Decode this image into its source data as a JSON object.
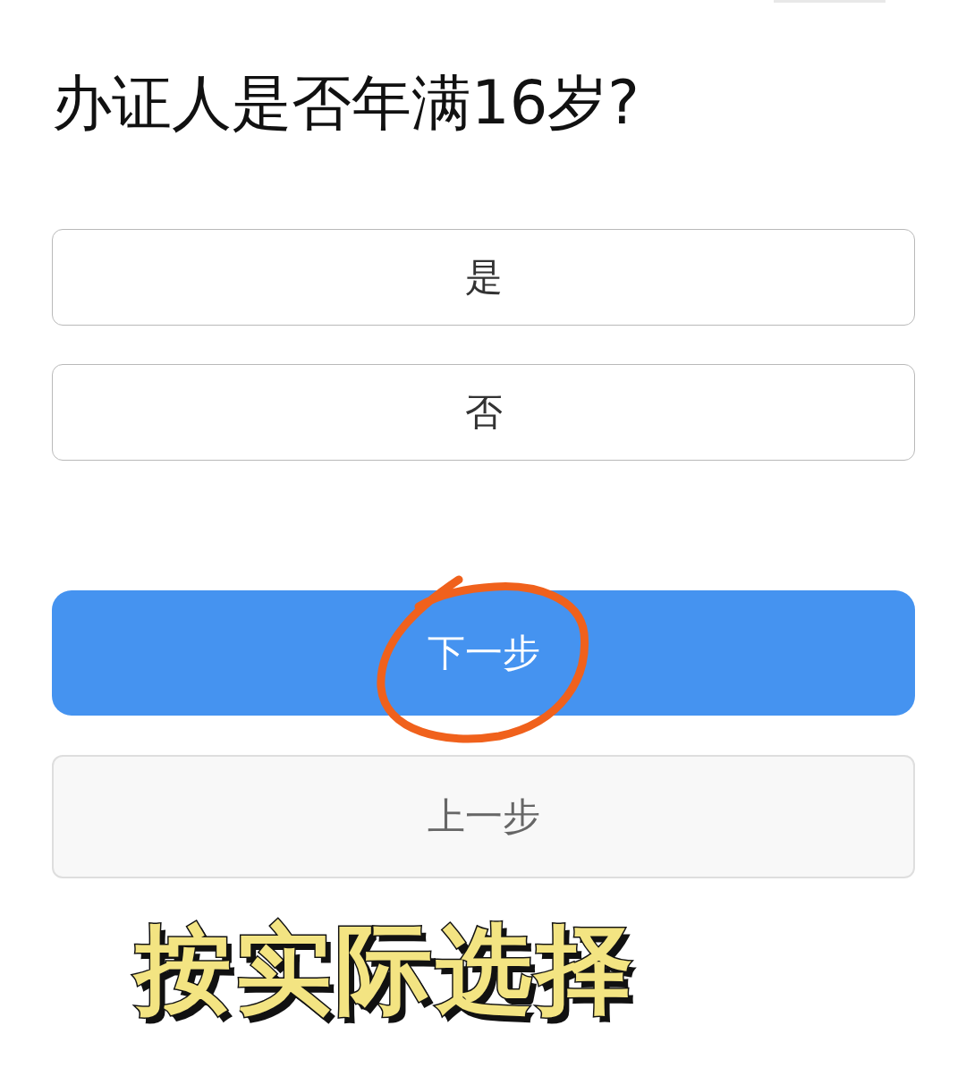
{
  "question": {
    "title": "办证人是否年满16岁?"
  },
  "options": [
    {
      "label": "是",
      "selected": false
    },
    {
      "label": "否",
      "selected": false
    }
  ],
  "buttons": [
    {
      "label": "下一步",
      "kind": "primary",
      "circled": true
    },
    {
      "label": "上一步",
      "kind": "secondary",
      "circled": false
    }
  ],
  "caption": "按实际选择"
}
